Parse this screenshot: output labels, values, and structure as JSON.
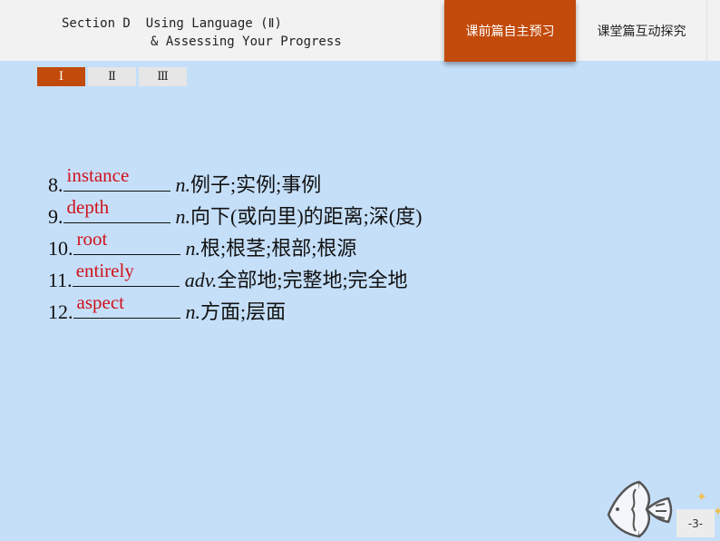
{
  "header": {
    "title_line1": "Section D  Using Language (Ⅱ)",
    "title_line2": "& Assessing Your Progress",
    "nav_tabs": [
      {
        "label": "课前篇自主预习",
        "active": true
      },
      {
        "label": "课堂篇互动探究",
        "active": false
      }
    ]
  },
  "subtabs": [
    {
      "label": "Ⅰ",
      "active": true
    },
    {
      "label": "Ⅱ",
      "active": false
    },
    {
      "label": "Ⅲ",
      "active": false
    }
  ],
  "vocab": [
    {
      "num": "8.",
      "answer": "instance",
      "pos": "n.",
      "meaning": "例子;实例;事例"
    },
    {
      "num": "9.",
      "answer": "depth",
      "pos": "n.",
      "meaning": "向下(或向里)的距离;深(度)"
    },
    {
      "num": "10.",
      "answer": "root",
      "pos": "n.",
      "meaning": "根;根茎;根部;根源"
    },
    {
      "num": "11.",
      "answer": "entirely",
      "pos": "adv.",
      "meaning": "全部地;完整地;完全地"
    },
    {
      "num": "12.",
      "answer": "aspect",
      "pos": "n.",
      "meaning": "方面;层面"
    }
  ],
  "footer": {
    "page_number": "-3-",
    "decoration_icon": "fish-icon"
  },
  "colors": {
    "accent": "#c24a0a",
    "background": "#c5dff9",
    "answer": "#d0121b"
  }
}
